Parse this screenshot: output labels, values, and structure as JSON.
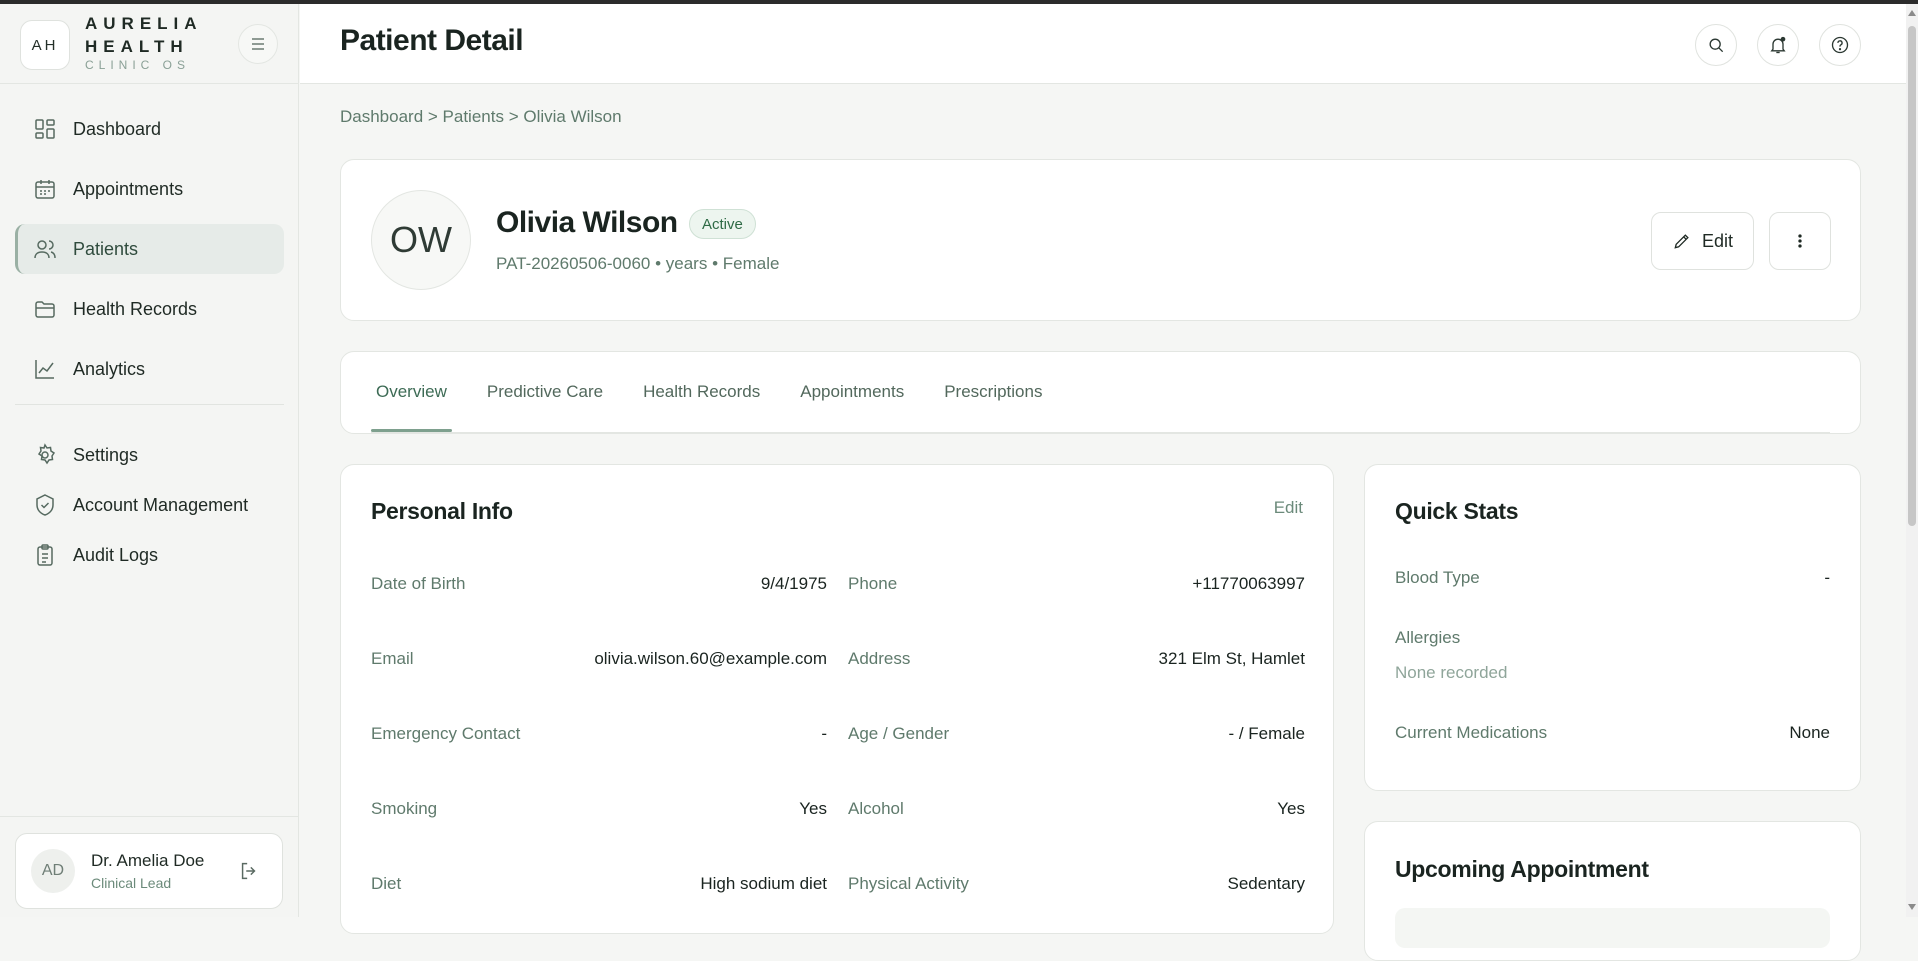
{
  "brand": {
    "initials": "AH",
    "line1": "AURELIA",
    "line2": "HEALTH",
    "sub": "CLINIC OS"
  },
  "sidebar": {
    "items": [
      {
        "label": "Dashboard",
        "icon": "dashboard-icon"
      },
      {
        "label": "Appointments",
        "icon": "calendar-icon"
      },
      {
        "label": "Patients",
        "icon": "users-icon",
        "active": true
      },
      {
        "label": "Health Records",
        "icon": "folder-icon"
      },
      {
        "label": "Analytics",
        "icon": "chart-icon"
      }
    ],
    "secondary": [
      {
        "label": "Settings",
        "icon": "gear-icon"
      },
      {
        "label": "Account Management",
        "icon": "shield-icon"
      },
      {
        "label": "Audit Logs",
        "icon": "clipboard-icon"
      }
    ]
  },
  "user": {
    "initials": "AD",
    "name": "Dr. Amelia Doe",
    "role": "Clinical Lead"
  },
  "header": {
    "title": "Patient Detail"
  },
  "breadcrumb": "Dashboard > Patients > Olivia Wilson",
  "patient": {
    "initials": "OW",
    "name": "Olivia Wilson",
    "status": "Active",
    "meta": "PAT-20260506-0060 • years • Female",
    "edit_label": "Edit"
  },
  "tabs": [
    "Overview",
    "Predictive Care",
    "Health Records",
    "Appointments",
    "Prescriptions"
  ],
  "personal_info": {
    "title": "Personal Info",
    "edit_label": "Edit",
    "left": [
      {
        "label": "Date of Birth",
        "value": "9/4/1975"
      },
      {
        "label": "Email",
        "value": "olivia.wilson.60@example.com"
      },
      {
        "label": "Emergency Contact",
        "value": "-"
      },
      {
        "label": "Smoking",
        "value": "Yes"
      },
      {
        "label": "Diet",
        "value": "High sodium diet"
      }
    ],
    "right": [
      {
        "label": "Phone",
        "value": "+11770063997"
      },
      {
        "label": "Address",
        "value": "321 Elm St, Hamlet"
      },
      {
        "label": "Age / Gender",
        "value": "- / Female"
      },
      {
        "label": "Alcohol",
        "value": "Yes"
      },
      {
        "label": "Physical Activity",
        "value": "Sedentary"
      }
    ]
  },
  "quick_stats": {
    "title": "Quick Stats",
    "blood_type_label": "Blood Type",
    "blood_type_value": "-",
    "allergies_label": "Allergies",
    "allergies_value": "None recorded",
    "medications_label": "Current Medications",
    "medications_value": "None"
  },
  "upcoming": {
    "title": "Upcoming Appointment"
  }
}
